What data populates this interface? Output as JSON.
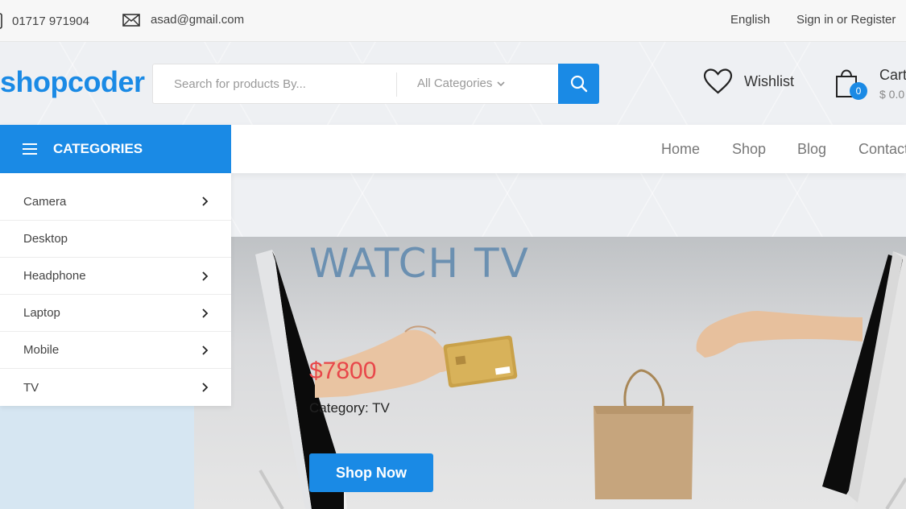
{
  "topbar": {
    "phone": "01717 971904",
    "email": "asad@gmail.com",
    "language": "English",
    "auth": "Sign in or Register"
  },
  "header": {
    "logo": "shopcoder",
    "search_placeholder": "Search for products By...",
    "category_select": "All Categories",
    "wishlist_label": "Wishlist",
    "cart_label": "Cart",
    "cart_count": "0",
    "cart_amount": "$ 0.0"
  },
  "nav": {
    "categories_label": "CATEGORIES",
    "links": [
      "Home",
      "Shop",
      "Blog",
      "Contact"
    ]
  },
  "categories": [
    {
      "label": "Camera",
      "has_sub": true
    },
    {
      "label": "Desktop",
      "has_sub": false
    },
    {
      "label": "Headphone",
      "has_sub": true
    },
    {
      "label": "Laptop",
      "has_sub": true
    },
    {
      "label": "Mobile",
      "has_sub": true
    },
    {
      "label": "TV",
      "has_sub": true
    }
  ],
  "hero": {
    "title": "WATCH TV",
    "price": "$7800",
    "category": "Category: TV",
    "button": "Shop Now"
  },
  "colors": {
    "accent": "#1a8ae5",
    "price": "#e8474a",
    "hero_title": "#6b90b1"
  }
}
